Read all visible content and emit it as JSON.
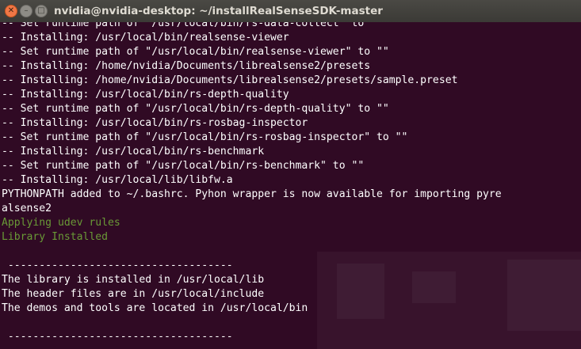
{
  "window": {
    "title": "nvidia@nvidia-desktop: ~/installRealSenseSDK-master",
    "close_glyph": "✕",
    "minimize_glyph": "–",
    "maximize_glyph": "□"
  },
  "terminal": {
    "lines": [
      {
        "text": "-- Set runtime path of \"/usr/local/bin/rs-data-collect\" to \"\"",
        "color": "white"
      },
      {
        "text": "-- Installing: /usr/local/bin/realsense-viewer",
        "color": "white"
      },
      {
        "text": "-- Set runtime path of \"/usr/local/bin/realsense-viewer\" to \"\"",
        "color": "white"
      },
      {
        "text": "-- Installing: /home/nvidia/Documents/librealsense2/presets",
        "color": "white"
      },
      {
        "text": "-- Installing: /home/nvidia/Documents/librealsense2/presets/sample.preset",
        "color": "white"
      },
      {
        "text": "-- Installing: /usr/local/bin/rs-depth-quality",
        "color": "white"
      },
      {
        "text": "-- Set runtime path of \"/usr/local/bin/rs-depth-quality\" to \"\"",
        "color": "white"
      },
      {
        "text": "-- Installing: /usr/local/bin/rs-rosbag-inspector",
        "color": "white"
      },
      {
        "text": "-- Set runtime path of \"/usr/local/bin/rs-rosbag-inspector\" to \"\"",
        "color": "white"
      },
      {
        "text": "-- Installing: /usr/local/bin/rs-benchmark",
        "color": "white"
      },
      {
        "text": "-- Set runtime path of \"/usr/local/bin/rs-benchmark\" to \"\"",
        "color": "white"
      },
      {
        "text": "-- Installing: /usr/local/lib/libfw.a",
        "color": "white"
      },
      {
        "text": "PYTHONPATH added to ~/.bashrc. Pyhon wrapper is now available for importing pyre",
        "color": "white"
      },
      {
        "text": "alsense2",
        "color": "white"
      },
      {
        "text": "Applying udev rules",
        "color": "green"
      },
      {
        "text": "Library Installed",
        "color": "green"
      },
      {
        "text": "",
        "color": "white"
      },
      {
        "text": " ------------------------------------",
        "color": "white"
      },
      {
        "text": "The library is installed in /usr/local/lib",
        "color": "white"
      },
      {
        "text": "The header files are in /usr/local/include",
        "color": "white"
      },
      {
        "text": "The demos and tools are located in /usr/local/bin",
        "color": "white"
      },
      {
        "text": "",
        "color": "white"
      },
      {
        "text": " ------------------------------------",
        "color": "white"
      }
    ]
  },
  "colors": {
    "terminal_bg": "#300a24",
    "text": "#ffffff",
    "success_text": "#73b33a",
    "titlebar": "#3c3b37",
    "close_button": "#f07746"
  }
}
